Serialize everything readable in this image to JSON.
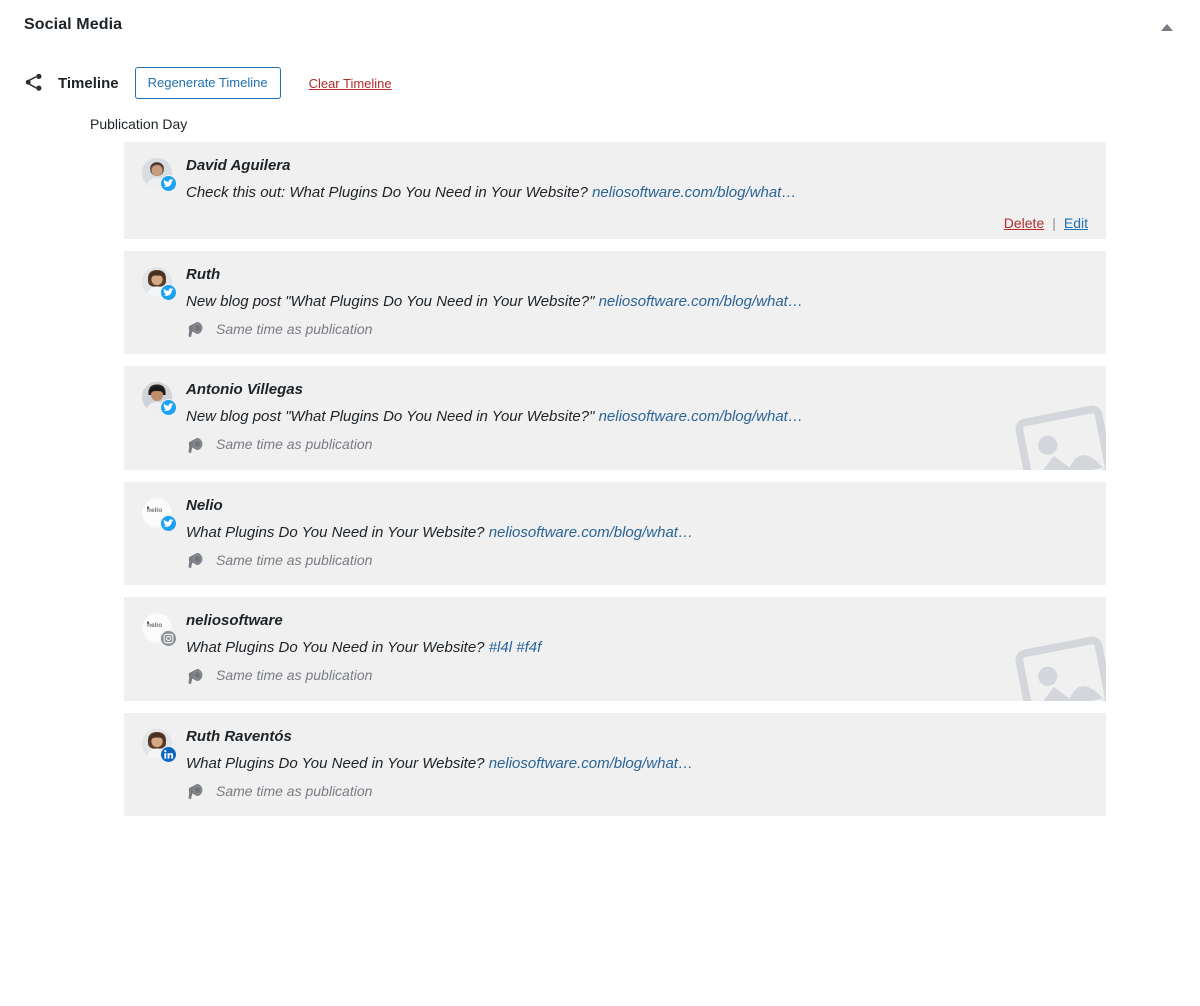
{
  "panel": {
    "title": "Social Media",
    "collapse_icon": "triangle-up-icon"
  },
  "toolbar": {
    "share_icon": "share-icon",
    "label": "Timeline",
    "regenerate_label": "Regenerate Timeline",
    "clear_label": "Clear Timeline"
  },
  "colors": {
    "accent_blue": "#2271b1",
    "danger_red": "#b32d2e",
    "card_bg": "#f0f0f1",
    "link_blue": "#2a6496",
    "muted": "#787c82",
    "twitter": "#1da1f2",
    "linkedin": "#0a66c2",
    "instagram": "#8b9096"
  },
  "timeline": {
    "day_label": "Publication Day",
    "messages": [
      {
        "author": "David Aguilera",
        "network": "twitter",
        "avatar_type": "photo-man",
        "text_prefix": "Check this out: What Plugins Do You Need in Your Website? ",
        "link": "neliosoftware.com/blog/what…",
        "schedule": null,
        "schedule_icon": "megaphone-icon",
        "actions": {
          "delete": "Delete",
          "separator": "|",
          "edit": "Edit"
        },
        "decorative_image": false
      },
      {
        "author": "Ruth",
        "network": "twitter",
        "avatar_type": "photo-woman",
        "text_prefix": "New blog post \"What Plugins Do You Need in Your Website?\" ",
        "link": "neliosoftware.com/blog/what…",
        "schedule": "Same time as publication",
        "schedule_icon": "megaphone-icon",
        "actions": null,
        "decorative_image": false
      },
      {
        "author": "Antonio Villegas",
        "network": "twitter",
        "avatar_type": "photo-man2",
        "text_prefix": "New blog post \"What Plugins Do You Need in Your Website?\" ",
        "link": "neliosoftware.com/blog/what…",
        "schedule": "Same time as publication",
        "schedule_icon": "megaphone-icon",
        "actions": null,
        "decorative_image": true
      },
      {
        "author": "Nelio",
        "network": "twitter",
        "avatar_type": "logo-nelio",
        "text_prefix": "What Plugins Do You Need in Your Website? ",
        "link": "neliosoftware.com/blog/what…",
        "schedule": "Same time as publication",
        "schedule_icon": "megaphone-icon",
        "actions": null,
        "decorative_image": false
      },
      {
        "author": "neliosoftware",
        "network": "instagram",
        "avatar_type": "logo-nelio",
        "text_prefix": "What Plugins Do You Need in Your Website? ",
        "link": "#l4l #f4f",
        "schedule": "Same time as publication",
        "schedule_icon": "megaphone-icon",
        "actions": null,
        "decorative_image": true
      },
      {
        "author": "Ruth Raventós",
        "network": "linkedin",
        "avatar_type": "photo-woman",
        "text_prefix": "What Plugins Do You Need in Your Website? ",
        "link": "neliosoftware.com/blog/what…",
        "schedule": "Same time as publication",
        "schedule_icon": "megaphone-icon",
        "actions": null,
        "decorative_image": false
      }
    ]
  }
}
